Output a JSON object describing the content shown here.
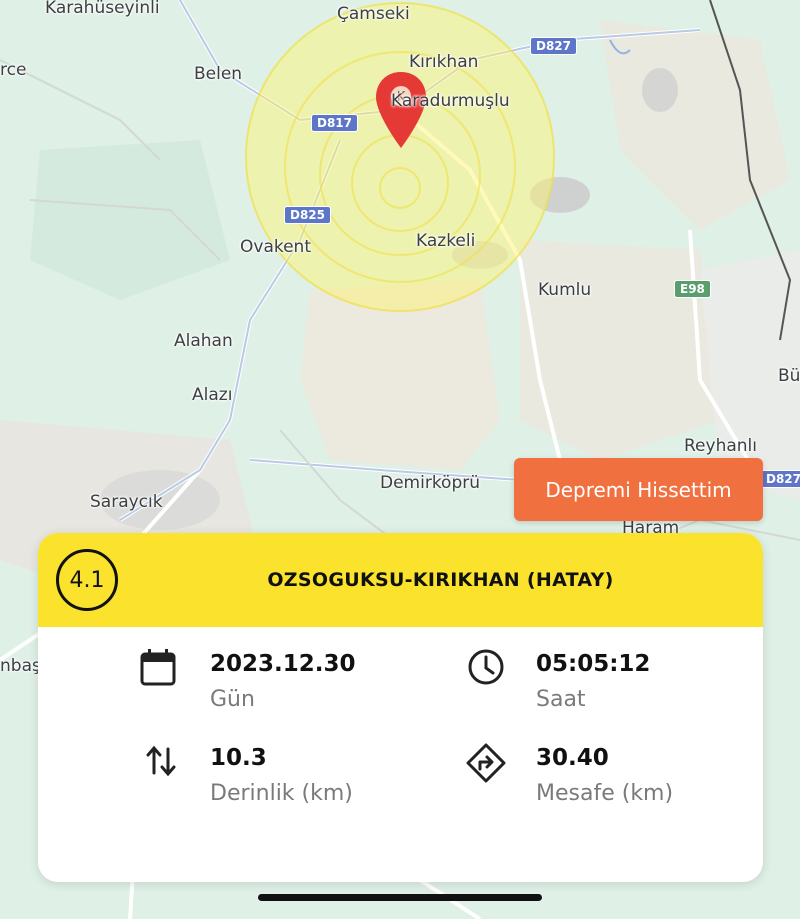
{
  "map": {
    "places": [
      "Karahüseyinli",
      "Çamseki",
      "rce",
      "Belen",
      "Kırıkhan",
      "Karadurmuşlu",
      "Ovakent",
      "Kazkeli",
      "Kumlu",
      "Alahan",
      "Alazı",
      "Bü",
      "Reyhanlı",
      "Demirköprü",
      "Saraycık",
      "Haram",
      "nbaş"
    ],
    "roads": [
      "D827",
      "D817",
      "D825",
      "E98",
      "D827"
    ],
    "pin_letter": "K"
  },
  "report_button": {
    "label": "Depremi Hissettim"
  },
  "card": {
    "magnitude": "4.1",
    "location": "OZSOGUKSU-KIRIKHAN (HATAY)",
    "date": {
      "value": "2023.12.30",
      "label": "Gün",
      "icon": "calendar-icon"
    },
    "time": {
      "value": "05:05:12",
      "label": "Saat",
      "icon": "clock-icon"
    },
    "depth": {
      "value": "10.3",
      "label": "Derinlik (km)",
      "icon": "up-down-arrows-icon"
    },
    "distance": {
      "value": "30.40",
      "label": "Mesafe (km)",
      "icon": "directions-icon"
    }
  },
  "colors": {
    "map_background": "#dff0e6",
    "accent_yellow": "#fbe22d",
    "button_orange": "#f0703f",
    "pin_red": "#e53935"
  }
}
